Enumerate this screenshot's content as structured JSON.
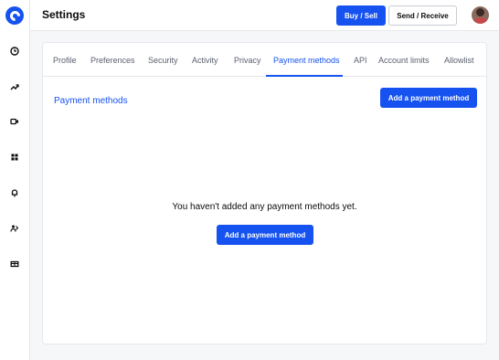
{
  "header": {
    "title": "Settings",
    "buy_sell_label": "Buy / Sell",
    "send_receive_label": "Send / Receive"
  },
  "sidebar": {
    "items": [
      {
        "icon": "clock-icon"
      },
      {
        "icon": "trending-icon"
      },
      {
        "icon": "video-icon"
      },
      {
        "icon": "grid-icon"
      },
      {
        "icon": "bell-icon"
      },
      {
        "icon": "users-icon"
      },
      {
        "icon": "gift-icon"
      }
    ]
  },
  "tabs": [
    {
      "label": "Profile"
    },
    {
      "label": "Preferences"
    },
    {
      "label": "Security"
    },
    {
      "label": "Activity"
    },
    {
      "label": "Privacy"
    },
    {
      "label": "Payment methods",
      "active": true
    },
    {
      "label": "API"
    },
    {
      "label": "Account limits"
    },
    {
      "label": "Allowlist"
    }
  ],
  "payment": {
    "section_title": "Payment methods",
    "add_button_label": "Add a payment method",
    "empty_message": "You haven't added any payment methods yet.",
    "add_center_label": "Add a payment method"
  },
  "colors": {
    "accent": "#1652f0",
    "background": "#f6f7f9"
  }
}
